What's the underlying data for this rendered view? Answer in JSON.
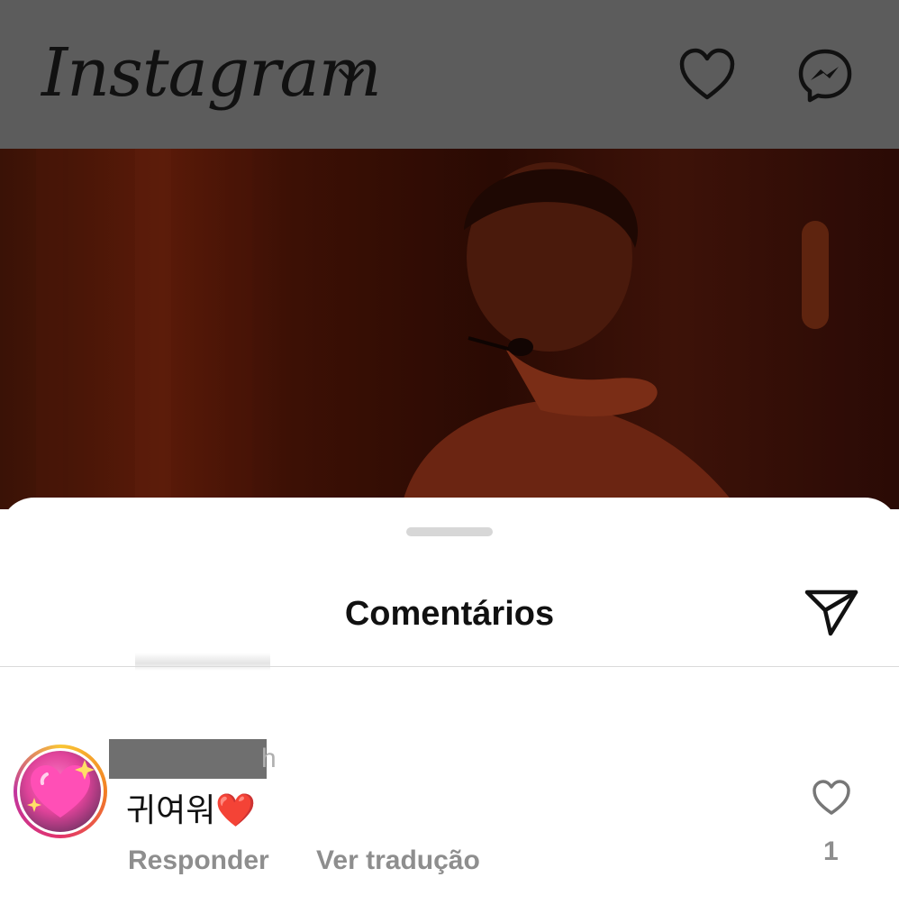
{
  "header": {
    "logo_text": "Instagram",
    "icons": [
      "chevron-down-icon",
      "heart-icon",
      "messenger-icon"
    ]
  },
  "sheet": {
    "title": "Comentários",
    "share_icon": "send-icon"
  },
  "comment": {
    "text": "귀여워❤️",
    "username_tail": "h",
    "actions": {
      "reply": "Responder",
      "translate": "Ver tradução"
    },
    "like_count": "1"
  },
  "colors": {
    "topbar_dim": "#5c5c5c",
    "secondary_text": "#8e8e8e"
  }
}
